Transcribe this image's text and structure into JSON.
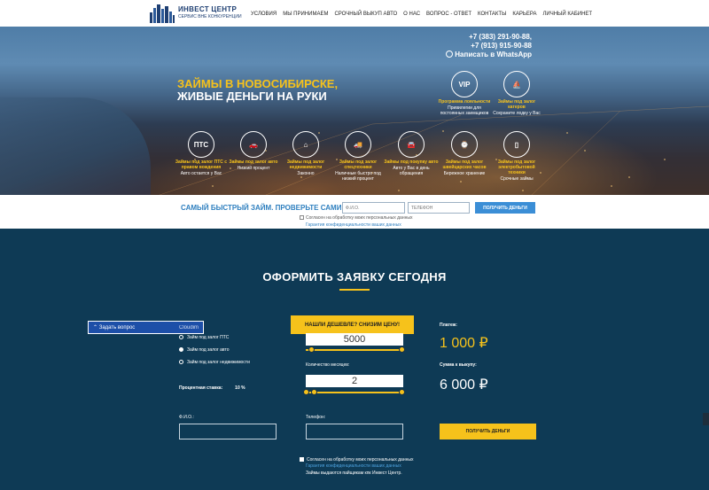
{
  "header": {
    "logo_title": "ИНВЕСТ ЦЕНТР",
    "logo_subtitle": "СЕРВИС ВНЕ КОНКУРЕНЦИИ",
    "nav": [
      "УСЛОВИЯ",
      "МЫ ПРИНИМАЕМ",
      "СРОЧНЫЙ ВЫКУП АВТО",
      "О НАС",
      "ВОПРОС - ОТВЕТ",
      "КОНТАКТЫ",
      "КАРЬЕРА",
      "ЛИЧНЫЙ КАБИНЕТ"
    ]
  },
  "hero": {
    "title_line1": "ЗАЙМЫ В НОВОСИБИРСКЕ,",
    "title_line2": "ЖИВЫЕ ДЕНЬГИ НА РУКИ",
    "phone1": "+7 (383) 291-90-88,",
    "phone2": "+7 (913) 915-90-88",
    "whatsapp": "Написать в WhatsApp",
    "top_circles": [
      {
        "icon": "vip-icon",
        "glyph": "VIP",
        "title": "Программа лояльности",
        "desc": "Привилегии для постоянных заемщиков"
      },
      {
        "icon": "sailboat-icon",
        "glyph": "⛵",
        "title": "Займы под залог катеров",
        "desc": "Сохраните лодку у Вас"
      }
    ],
    "bottom_circles": [
      {
        "icon": "pts-icon",
        "glyph": "ПТС",
        "title": "Займы под залог ПТС с правом вождения",
        "desc": "Авто остается у Вас"
      },
      {
        "icon": "car-icon",
        "glyph": "🚗",
        "title": "Займы под залог авто",
        "desc": "Низкий процент"
      },
      {
        "icon": "house-icon",
        "glyph": "⌂",
        "title": "Займы под залог недвижимости",
        "desc": "Законно"
      },
      {
        "icon": "tow-truck-icon",
        "glyph": "🚚",
        "title": "Займы под залог спецтехники",
        "desc": "Наличные быстро под низкий процент"
      },
      {
        "icon": "car-front-icon",
        "glyph": "🚘",
        "title": "Займы под покупку авто",
        "desc": "Авто у Вас в день обращения"
      },
      {
        "icon": "watch-icon",
        "glyph": "⌚",
        "title": "Займы под залог швейцарских часов",
        "desc": "Бережное хранение"
      },
      {
        "icon": "phone-icon",
        "glyph": "▯",
        "title": "Займы под залог электробытовой техники",
        "desc": "Срочные займы"
      }
    ]
  },
  "quick_form": {
    "title": "САМЫЙ БЫСТРЫЙ ЗАЙМ. ПРОВЕРЬТЕ САМИ!",
    "name_placeholder": "Ф.И.О.",
    "phone_placeholder": "ТЕЛЕФОН",
    "button": "ПОЛУЧИТЬ ДЕНЬГИ",
    "consent": "Согласен на обработку моих персональных данных",
    "privacy_link": "Гарантия конфиденциальности ваших данных"
  },
  "application": {
    "title": "ОФОРМИТЬ ЗАЯВКУ СЕГОДНЯ",
    "ask_question": "Задать вопрос",
    "ask_brand": "Cloudim",
    "options": [
      "Займ под залог ПТС",
      "Займ под залог авто",
      "Займ под залог недвижимости"
    ],
    "selected_option": 1,
    "rate_label": "Процентная ставка:",
    "rate_value": "10 %",
    "banner": "НАШЛИ ДЕШЕВЛЕ? СНИЗИМ ЦЕНУ!",
    "amount_value": "5000",
    "amount_fraction": 0.05,
    "months_label": "Количество месяцев:",
    "months_value": "2",
    "months_fraction": 0.08,
    "payment_label": "Платеж:",
    "payment_value": "1 000 ₽",
    "total_label": "Сумма к выкупу:",
    "total_value": "6 000 ₽",
    "fio_label": "Ф.И.О.:",
    "phone_label": "Телефон:",
    "submit": "ПОЛУЧИТЬ ДЕНЬГИ",
    "consent": "Согласен на обработку моих персональных данных",
    "privacy_link": "Гарантия конфиденциальности ваших данных",
    "note": "Займы выдаются пайщикам кпк Инвест Центр."
  },
  "colors": {
    "accent": "#f6c21b",
    "section_bg": "#0e3a55",
    "link": "#2e7fbf",
    "button_blue": "#3b8ed6"
  }
}
